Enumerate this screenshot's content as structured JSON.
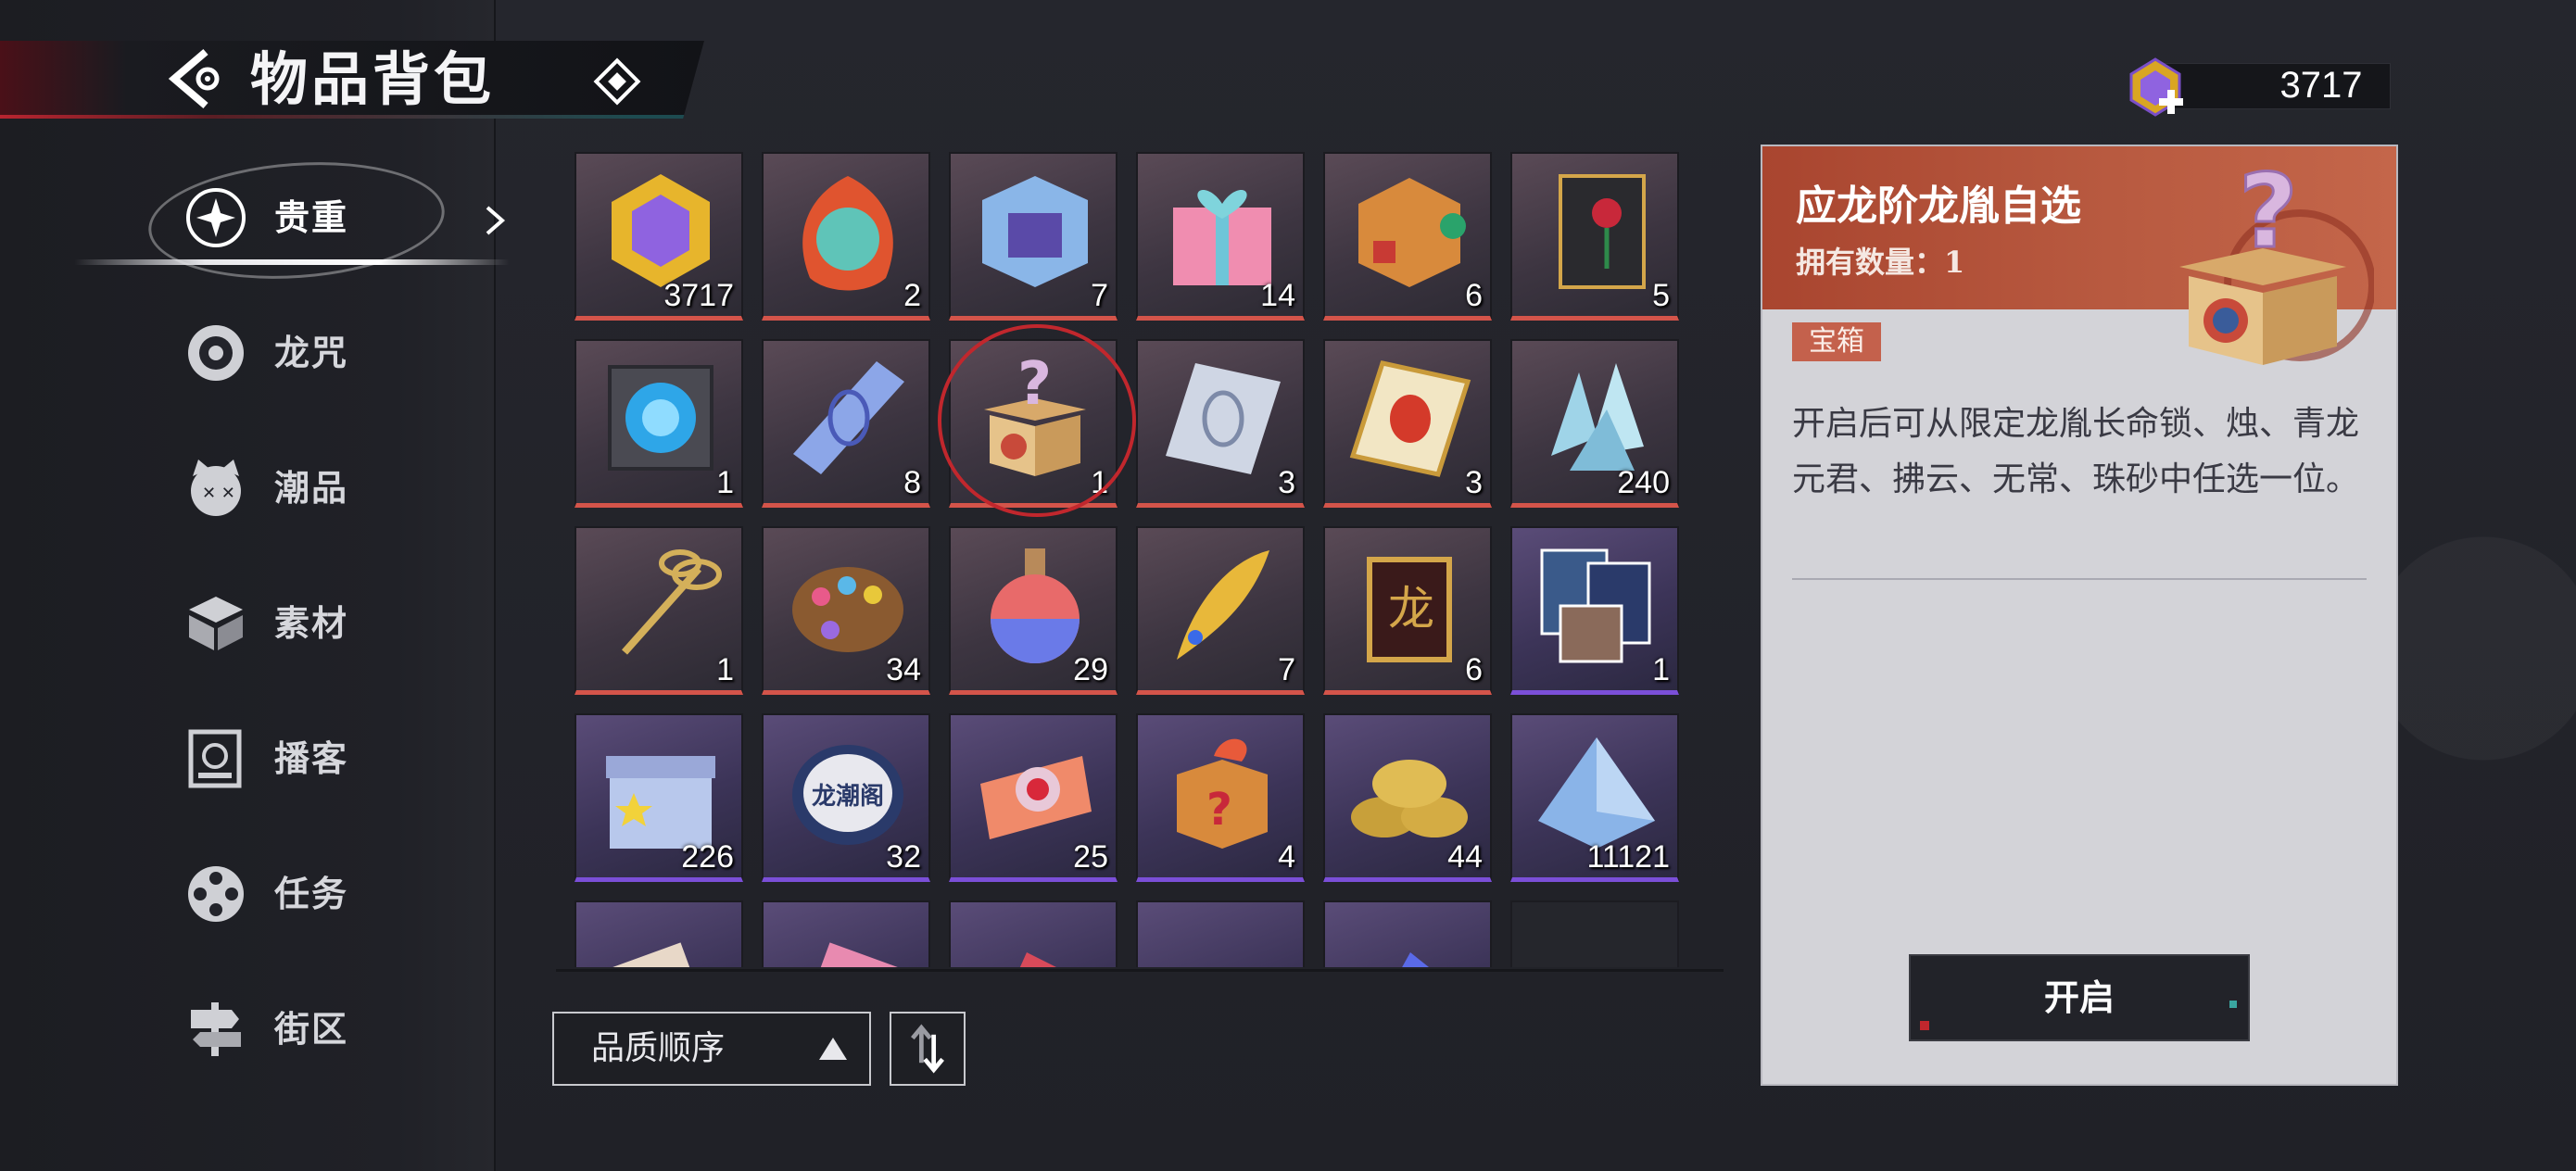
{
  "header": {
    "title": "物品背包"
  },
  "currency": {
    "amount": "3717"
  },
  "sidebar": {
    "items": [
      {
        "label": "贵重",
        "icon": "sparkle-star-icon",
        "active": true
      },
      {
        "label": "龙咒",
        "icon": "spiral-disc-icon"
      },
      {
        "label": "潮品",
        "icon": "cat-face-icon"
      },
      {
        "label": "素材",
        "icon": "cube-stack-icon"
      },
      {
        "label": "播客",
        "icon": "podcast-card-icon"
      },
      {
        "label": "任务",
        "icon": "film-reel-icon"
      },
      {
        "label": "街区",
        "icon": "signpost-icon"
      }
    ]
  },
  "inventory": {
    "rows": [
      [
        {
          "icon": "gold-gem-icon",
          "count": "3717",
          "quality": "red"
        },
        {
          "icon": "flame-mask-icon",
          "count": "2",
          "quality": "red"
        },
        {
          "icon": "holo-cube-icon",
          "count": "7",
          "quality": "red"
        },
        {
          "icon": "heart-gift-box-icon",
          "count": "14",
          "quality": "red"
        },
        {
          "icon": "puzzle-cube-icon",
          "count": "6",
          "quality": "red"
        },
        {
          "icon": "rose-card-icon",
          "count": "5",
          "quality": "red"
        }
      ],
      [
        {
          "icon": "orb-cube-icon",
          "count": "1",
          "quality": "red"
        },
        {
          "icon": "crystal-shard-icon",
          "count": "8",
          "quality": "red"
        },
        {
          "icon": "mystery-box-icon",
          "count": "1",
          "quality": "red",
          "selected": true
        },
        {
          "icon": "silver-ticket-icon",
          "count": "3",
          "quality": "red"
        },
        {
          "icon": "gold-ticket-icon",
          "count": "3",
          "quality": "red"
        },
        {
          "icon": "ice-crystal-icon",
          "count": "240",
          "quality": "red"
        }
      ],
      [
        {
          "icon": "golden-scissors-icon",
          "count": "1",
          "quality": "red"
        },
        {
          "icon": "paint-palette-icon",
          "count": "34",
          "quality": "red"
        },
        {
          "icon": "potion-bottle-icon",
          "count": "29",
          "quality": "red"
        },
        {
          "icon": "golden-quill-icon",
          "count": "7",
          "quality": "red"
        },
        {
          "icon": "gold-plaque-icon",
          "count": "6",
          "quality": "red"
        },
        {
          "icon": "character-cards-icon",
          "count": "1",
          "quality": "purple"
        }
      ],
      [
        {
          "icon": "star-gift-box-icon",
          "count": "226",
          "quality": "purple"
        },
        {
          "icon": "badge-tin-icon",
          "count": "32",
          "quality": "purple",
          "text": "龙潮阁"
        },
        {
          "icon": "candy-box-icon",
          "count": "25",
          "quality": "purple"
        },
        {
          "icon": "surprise-box-icon",
          "count": "4",
          "quality": "purple"
        },
        {
          "icon": "gold-coins-icon",
          "count": "44",
          "quality": "purple"
        },
        {
          "icon": "crystal-pile-icon",
          "count": "11121",
          "quality": "purple"
        }
      ],
      [
        {
          "icon": "ticket-stub-icon",
          "count": "",
          "quality": "purple"
        },
        {
          "icon": "pink-ticket-icon",
          "count": "",
          "quality": "purple"
        },
        {
          "icon": "red-shard-icon",
          "count": "",
          "quality": "purple"
        },
        {
          "icon": "eye-amulet-icon",
          "count": "",
          "quality": "purple"
        },
        {
          "icon": "blue-shard-icon",
          "count": "",
          "quality": "purple"
        },
        {
          "icon": "",
          "count": "",
          "quality": "empty"
        }
      ]
    ]
  },
  "sort": {
    "label": "品质顺序"
  },
  "detail": {
    "name": "应龙阶龙胤自选",
    "own": "拥有数量：1",
    "tag": "宝箱",
    "description": "开启后可从限定龙胤长命锁、烛、青龙元君、拂云、无常、珠砂中任选一位。",
    "button": "开启"
  },
  "colors": {
    "quality_red": "#d4544a",
    "quality_purple": "#7b4fd8",
    "detail_header": "#b85a40",
    "selection_ring": "#c1272d"
  }
}
